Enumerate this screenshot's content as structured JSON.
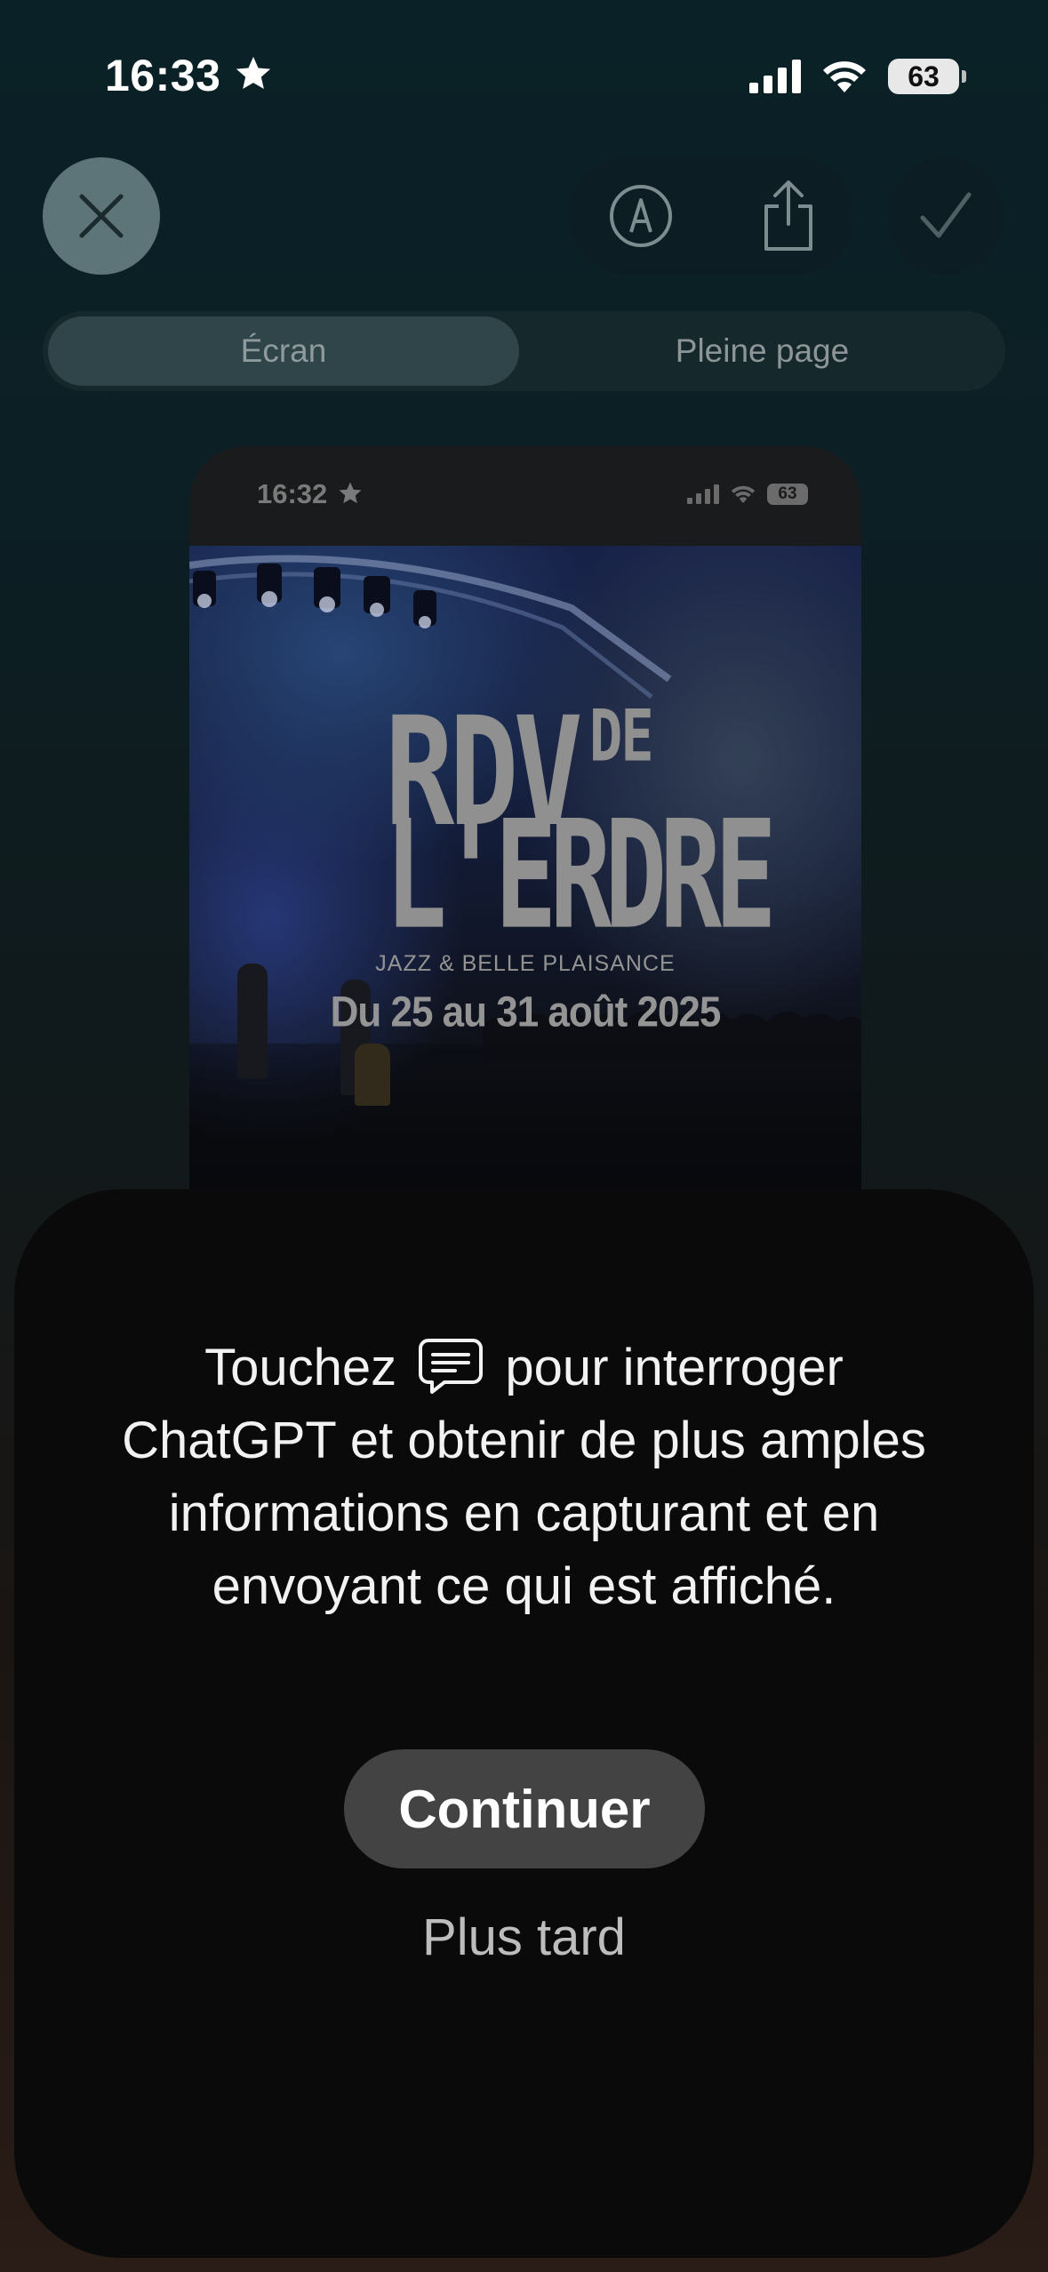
{
  "status_bar": {
    "time": "16:33",
    "battery": "63"
  },
  "toolbar": {
    "close_icon": "close-icon",
    "markup_icon": "markup-pen-icon",
    "share_icon": "share-icon",
    "done_icon": "checkmark-icon"
  },
  "segments": {
    "screen_label": "Écran",
    "full_page_label": "Pleine page",
    "selected": "Écran"
  },
  "preview": {
    "status_time": "16:32",
    "status_battery": "63",
    "poster": {
      "title_line1": "RDV",
      "title_de": "DE",
      "title_line2": "L'ERDRE",
      "subtitle": "JAZZ & BELLE PLAISANCE",
      "dates": "Du 25 au 31 août 2025"
    }
  },
  "sheet": {
    "message_before_icon": "Touchez",
    "message_after_icon": "pour interroger ChatGPT et obtenir de plus amples informations en capturant et en envoyant ce qui est affiché.",
    "icon": "chat-bubble-icon",
    "continue_label": "Continuer",
    "later_label": "Plus tard"
  },
  "colors": {
    "sheet_bg": "#0a0a0a",
    "button_bg": "#434343",
    "close_bg": "#5d7478"
  }
}
